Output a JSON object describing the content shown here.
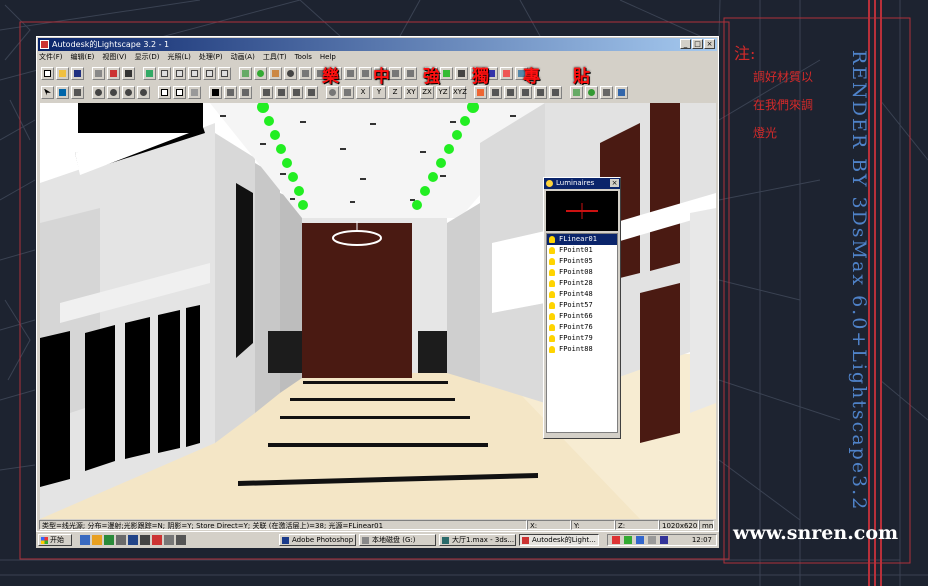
{
  "window": {
    "title": "Autodesk的Lightscape 3.2 - 1",
    "controls": [
      "_",
      "□",
      "×"
    ]
  },
  "menu": [
    "文件(F)",
    "编辑(E)",
    "视图(V)",
    "显示(D)",
    "光照(L)",
    "处理(P)",
    "动画(A)",
    "工具(T)",
    "Tools",
    "Help"
  ],
  "toolbar_axes": [
    "X",
    "Y",
    "Z",
    "XY",
    "ZX",
    "YZ",
    "XYZ"
  ],
  "overlay_title": [
    "樂",
    "中",
    "強",
    "獨",
    "專",
    "貼"
  ],
  "luminaires": {
    "title": "Luminaires",
    "items": [
      "FLinear01",
      "FPoint01",
      "FPoint05",
      "FPoint08",
      "FPoint28",
      "FPoint48",
      "FPoint57",
      "FPoint66",
      "FPoint76",
      "FPoint79",
      "FPoint88"
    ],
    "selected_index": 0
  },
  "statusbar": {
    "message": "类型=线光源; 分布=漫射;光影跟踪=N; 阴影=Y; Store Direct=Y; 关联 (在激活层上)=38; 光源=FLinear01",
    "x": "X:",
    "y": "Y:",
    "z": "Z:",
    "resolution": "1020x620",
    "units": "mm"
  },
  "taskbar": {
    "start": "开始",
    "buttons": [
      "Adobe Photoshop",
      "本地磁盘 (G:)",
      "大厅1.max - 3ds...",
      "Autodesk的Light..."
    ],
    "active_index": 3,
    "clock": "12:07"
  },
  "note": {
    "heading": "注:",
    "lines": [
      "調好材質以",
      "在我們來調",
      "燈光"
    ]
  },
  "render_credit": "RENDER BY 3DsMax 6.0+Lightscape3.2",
  "website": "www.snren.com",
  "colors": {
    "desktop_bg": "#1d2330",
    "overlay_red": "#ff1010",
    "credit_blue": "#4f82c8",
    "titlebar": "#0a246a"
  }
}
